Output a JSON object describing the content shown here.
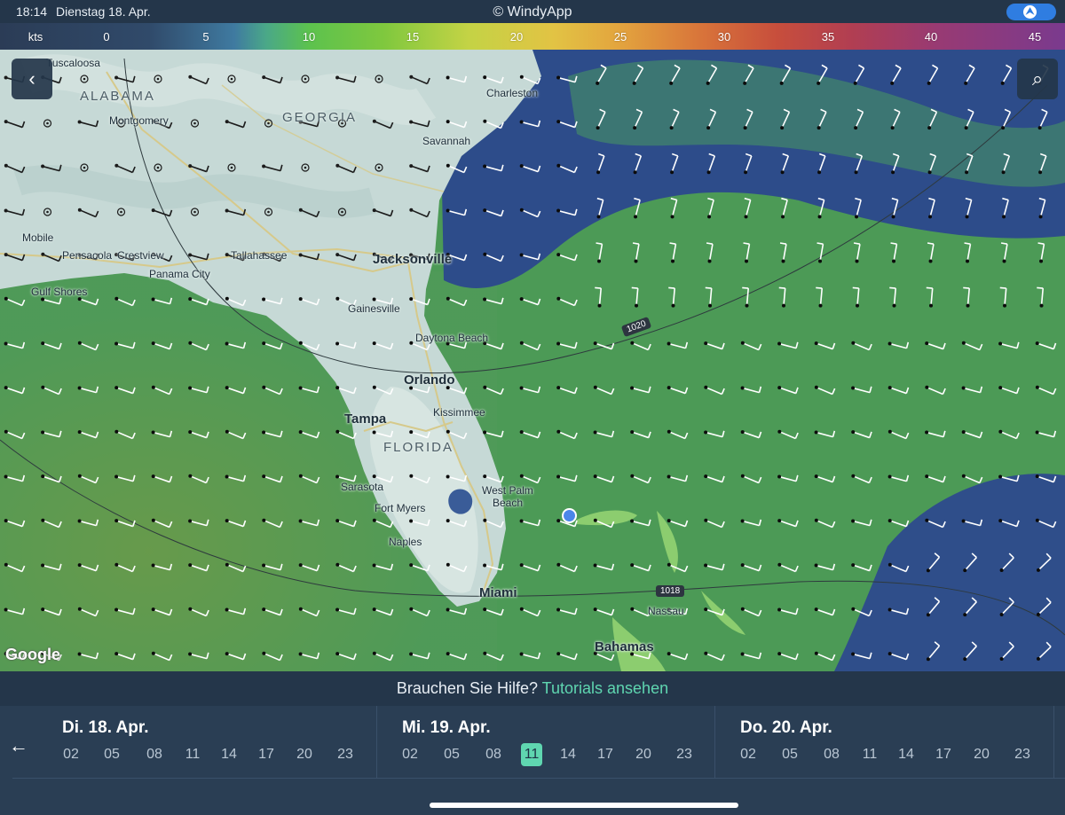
{
  "status": {
    "time": "18:14",
    "date": "Dienstag 18. Apr.",
    "app_title": "© WindyApp",
    "location_icon": "location-arrow-icon",
    "location_glyph": "⮝"
  },
  "legend": {
    "unit": "kts",
    "ticks": [
      "0",
      "5",
      "10",
      "15",
      "20",
      "25",
      "30",
      "35",
      "40",
      "45"
    ]
  },
  "map": {
    "back_glyph": "‹",
    "search_glyph": "⌕",
    "attribution": "Google",
    "states": {
      "alabama": "ALABAMA",
      "georgia": "GEORGIA",
      "florida": "FLORIDA"
    },
    "cities": {
      "tuscaloosa": "Tuscaloosa",
      "montgomery": "Montgomery",
      "mobile": "Mobile",
      "pensacola": "Pensacola",
      "crestview": "Crestview",
      "panama_city": "Panama City",
      "gulf_shores": "Gulf Shores",
      "tallahassee": "Tallahassee",
      "jacksonville": "Jacksonville",
      "gainesville": "Gainesville",
      "daytona_beach": "Daytona Beach",
      "orlando": "Orlando",
      "kissimmee": "Kissimmee",
      "tampa": "Tampa",
      "sarasota": "Sarasota",
      "fort_myers": "Fort Myers",
      "naples": "Naples",
      "west_palm_beach_1": "West Palm",
      "west_palm_beach_2": "Beach",
      "miami": "Miami",
      "nassau": "Nassau",
      "bahamas": "Bahamas",
      "charleston": "Charleston",
      "savannah": "Savannah"
    },
    "isobars": {
      "upper": "1020",
      "lower": "1018"
    }
  },
  "help": {
    "question": "Brauchen Sie Hilfe?",
    "link": "Tutorials ansehen"
  },
  "timeline": {
    "back_glyph": "←",
    "days": [
      {
        "label": "Di. 18. Apr.",
        "hours": [
          "02",
          "05",
          "08",
          "11",
          "14",
          "17",
          "20",
          "23"
        ]
      },
      {
        "label": "Mi. 19. Apr.",
        "hours": [
          "02",
          "05",
          "08",
          "11",
          "14",
          "17",
          "20",
          "23"
        ]
      },
      {
        "label": "Do. 20. Apr.",
        "hours": [
          "02",
          "05",
          "08",
          "11",
          "14",
          "17",
          "20",
          "23"
        ]
      }
    ],
    "selected": {
      "day": "Mi. 19. Apr.",
      "hour": "11"
    }
  },
  "colors": {
    "land": "#c9dcd8",
    "water_calm": "#2c4c86",
    "water_mid": "#4c9a56",
    "accent": "#5fd6b0",
    "ui_dark": "#24364a"
  }
}
